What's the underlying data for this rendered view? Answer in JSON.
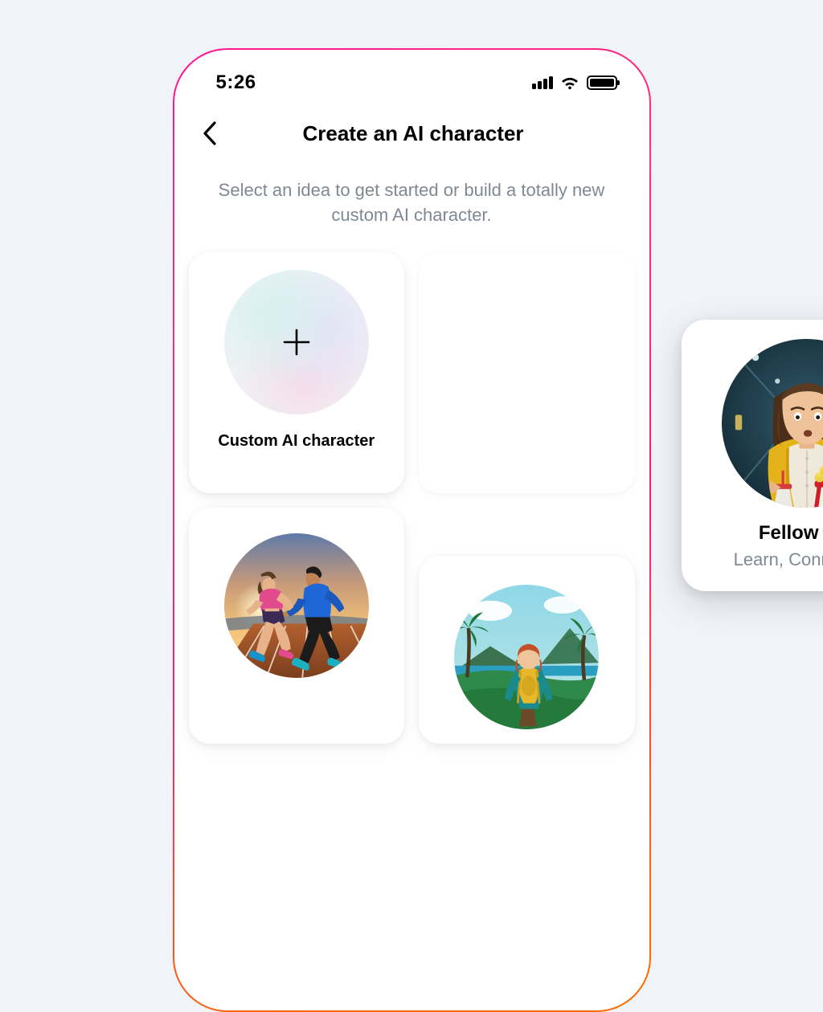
{
  "status_bar": {
    "time": "5:26"
  },
  "header": {
    "title": "Create an AI character"
  },
  "subtitle": "Select an idea to get started or build a totally new custom AI character.",
  "cards": {
    "custom": {
      "title": "Custom AI character"
    },
    "featured": {
      "title": "Fellow fan",
      "tags": "Learn, Connection"
    }
  }
}
